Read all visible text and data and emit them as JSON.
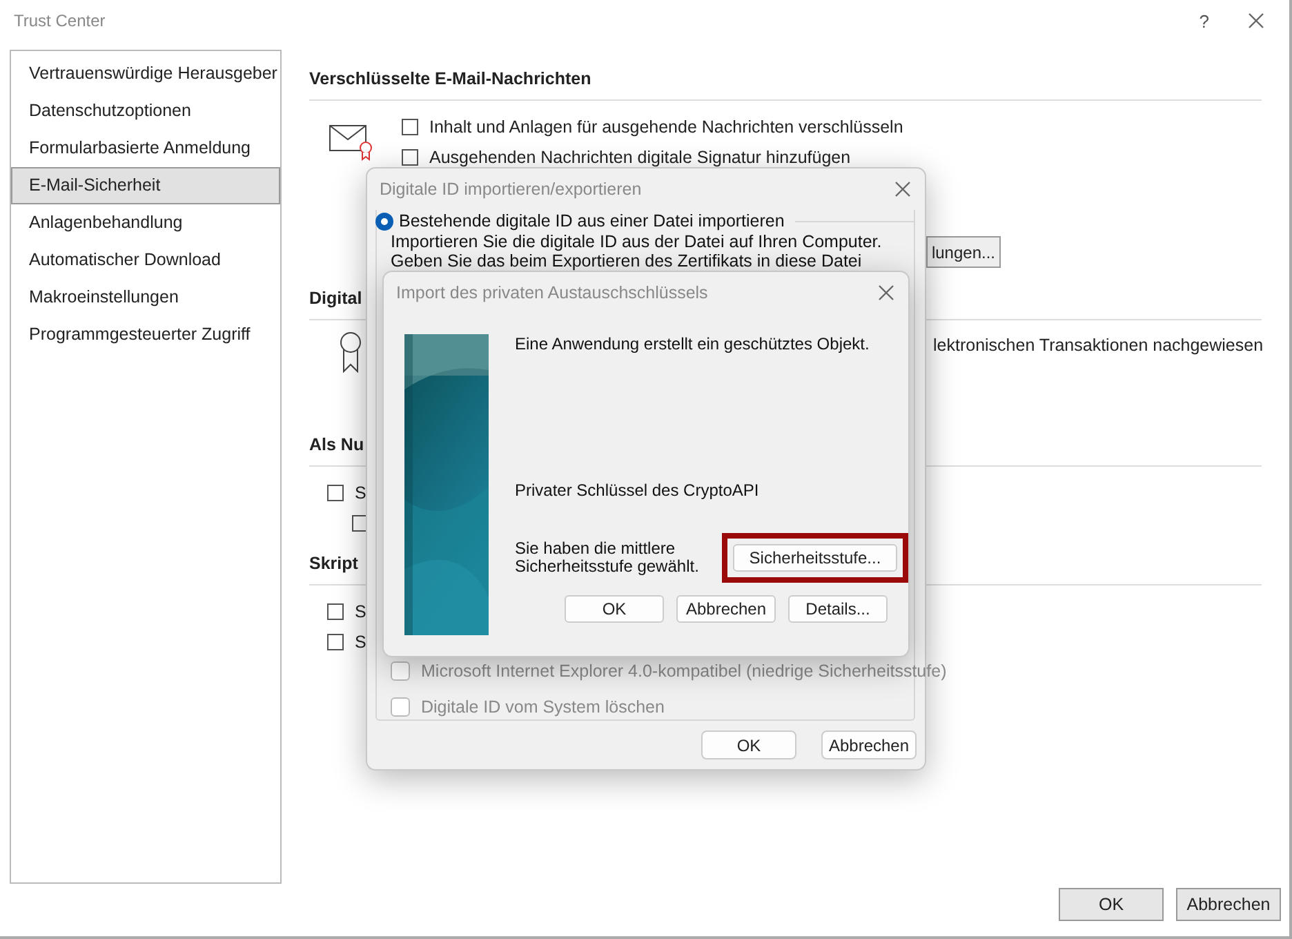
{
  "window": {
    "title": "Trust Center",
    "help": "?"
  },
  "sidebar": {
    "items": [
      {
        "label": "Vertrauenswürdige Herausgeber",
        "selected": false
      },
      {
        "label": "Datenschutzoptionen",
        "selected": false
      },
      {
        "label": "Formularbasierte Anmeldung",
        "selected": false
      },
      {
        "label": "E-Mail-Sicherheit",
        "selected": true
      },
      {
        "label": "Anlagenbehandlung",
        "selected": false
      },
      {
        "label": "Automatischer Download",
        "selected": false
      },
      {
        "label": "Makroeinstellungen",
        "selected": false
      },
      {
        "label": "Programmgesteuerter Zugriff",
        "selected": false
      }
    ]
  },
  "email_section": {
    "heading": "Verschlüsselte E-Mail-Nachrichten",
    "options": [
      {
        "label": "Inhalt und Anlagen für ausgehende Nachrichten verschlüsseln",
        "checked": false
      },
      {
        "label": "Ausgehenden Nachrichten digitale Signatur hinzufügen",
        "checked": false
      }
    ],
    "settings_button": "lungen..."
  },
  "digital_ids_section": {
    "heading": "Digital",
    "description": "lektronischen Transaktionen nachgewiesen"
  },
  "plaintext_section": {
    "heading": "Als Nu",
    "option": {
      "label": "S",
      "checked": false
    },
    "sub_option": {
      "checked": false
    }
  },
  "script_section": {
    "heading": "Skript",
    "options": [
      {
        "label": "S",
        "checked": false
      },
      {
        "label": "S",
        "checked": false
      }
    ]
  },
  "buttons": [
    "OK",
    "Abbrechen"
  ],
  "export_dialog": {
    "title": "Digitale ID importieren/exportieren",
    "mode": {
      "label": "Bestehende digitale ID aus einer Datei importieren",
      "selected": true
    },
    "description": [
      "Importieren Sie die digitale ID aus der Datei auf Ihren Computer.",
      "Geben Sie das beim Exportieren des Zertifikats in diese Datei"
    ],
    "checkboxes": [
      {
        "label": "Microsoft Internet Explorer 4.0-kompatibel (niedrige Sicherheitsstufe)",
        "checked": false,
        "disabled": true
      },
      {
        "label": "Digitale ID vom System löschen",
        "checked": false,
        "disabled": true
      }
    ],
    "buttons": [
      "OK",
      "Abbrechen"
    ]
  },
  "key_dialog": {
    "title": "Import des privaten Austauschschlüssels",
    "message": "Eine Anwendung erstellt ein geschütztes Objekt.",
    "key_name": "Privater Schlüssel des CryptoAPI",
    "level_text": "Sie haben die mittlere Sicherheitsstufe gewählt.",
    "level_button": {
      "label": "Sicherheitsstufe...",
      "highlighted": true
    },
    "buttons": [
      "OK",
      "Abbrechen",
      "Details..."
    ]
  }
}
